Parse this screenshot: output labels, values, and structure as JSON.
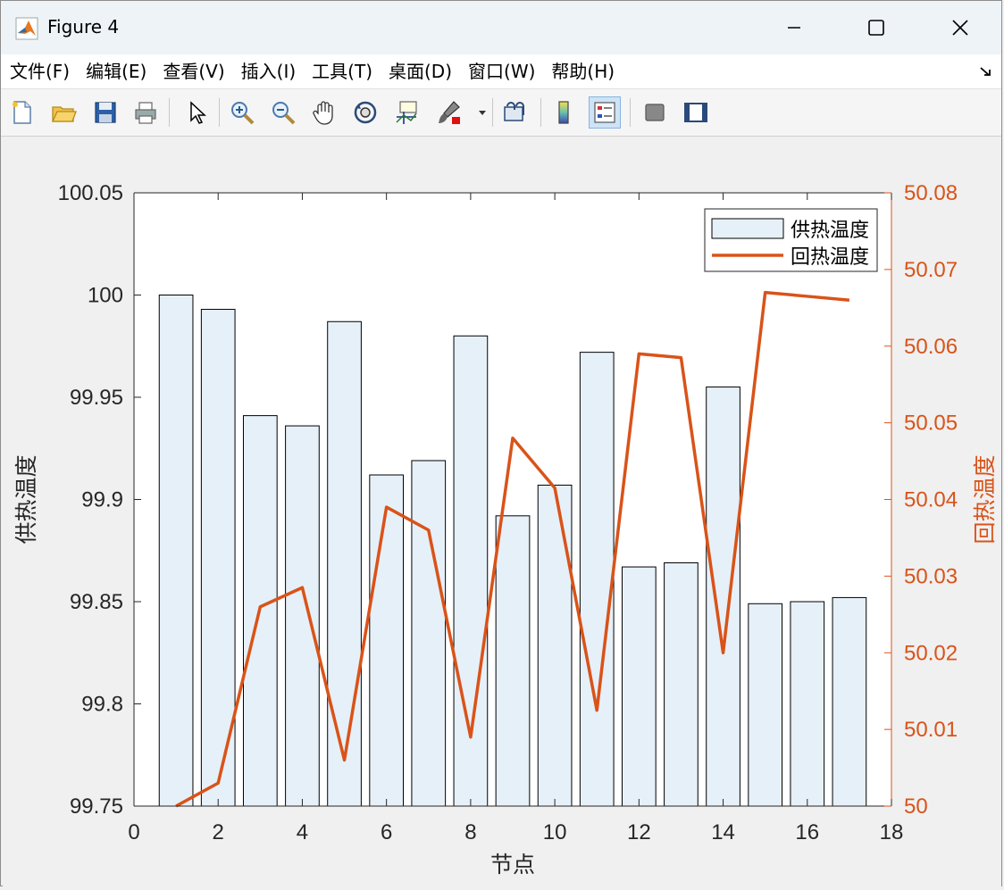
{
  "window": {
    "title": "Figure 4"
  },
  "menu": [
    {
      "label": "文件(F)"
    },
    {
      "label": "编辑(E)"
    },
    {
      "label": "查看(V)"
    },
    {
      "label": "插入(I)"
    },
    {
      "label": "工具(T)"
    },
    {
      "label": "桌面(D)"
    },
    {
      "label": "窗口(W)"
    },
    {
      "label": "帮助(H)"
    }
  ],
  "toolbar": [
    {
      "icon": "new-figure-icon"
    },
    {
      "icon": "open-file-icon"
    },
    {
      "icon": "save-icon"
    },
    {
      "icon": "print-icon"
    },
    {
      "icon": "pointer-icon"
    },
    {
      "icon": "zoom-in-icon"
    },
    {
      "icon": "zoom-out-icon"
    },
    {
      "icon": "pan-hand-icon"
    },
    {
      "icon": "rotate-3d-icon"
    },
    {
      "icon": "data-cursor-icon"
    },
    {
      "icon": "brush-icon"
    },
    {
      "icon": "link-plot-icon"
    },
    {
      "icon": "colorbar-icon"
    },
    {
      "icon": "legend-icon"
    },
    {
      "icon": "hide-plot-tools-icon"
    },
    {
      "icon": "show-plot-tools-icon"
    }
  ],
  "colors": {
    "bar_fill": "#e6f0f8",
    "bar_stroke": "#000000",
    "line": "#d95319",
    "right_axis": "#d95319"
  },
  "chart_data": {
    "type": "bar",
    "xlabel": "节点",
    "ylabel": "供热温度",
    "y2label": "回热温度",
    "xlim": [
      0,
      18
    ],
    "ylim": [
      99.75,
      100.05
    ],
    "y2lim": [
      50,
      50.08
    ],
    "xticks": [
      "0",
      "2",
      "4",
      "6",
      "8",
      "10",
      "12",
      "14",
      "16",
      "18"
    ],
    "yticks": [
      "99.75",
      "99.8",
      "99.85",
      "99.9",
      "99.95",
      "100",
      "100.05"
    ],
    "y2ticks": [
      "50",
      "50.01",
      "50.02",
      "50.03",
      "50.04",
      "50.05",
      "50.06",
      "50.07",
      "50.08"
    ],
    "legend_position": "top-right",
    "series": [
      {
        "name": "供热温度",
        "type": "bar",
        "axis": "left",
        "x": [
          1,
          2,
          3,
          4,
          5,
          6,
          7,
          8,
          9,
          10,
          11,
          12,
          13,
          14,
          15,
          16,
          17
        ],
        "values": [
          100.0,
          99.993,
          99.941,
          99.936,
          99.987,
          99.912,
          99.919,
          99.98,
          99.892,
          99.907,
          99.972,
          99.867,
          99.869,
          99.955,
          99.849,
          99.85,
          99.852
        ]
      },
      {
        "name": "回热温度",
        "type": "line",
        "axis": "right",
        "x": [
          1,
          2,
          3,
          4,
          5,
          6,
          7,
          8,
          9,
          10,
          11,
          12,
          13,
          14,
          15,
          16,
          17
        ],
        "values": [
          50.0,
          50.003,
          50.026,
          50.0285,
          50.006,
          50.039,
          50.036,
          50.009,
          50.048,
          50.0415,
          50.0125,
          50.059,
          50.0585,
          50.02,
          50.067,
          50.0665,
          50.066
        ]
      }
    ]
  }
}
